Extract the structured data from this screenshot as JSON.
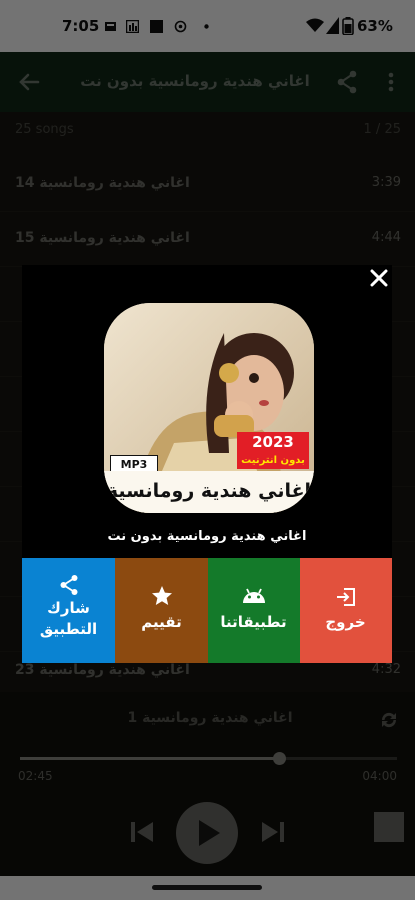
{
  "status_bar": {
    "time": "7:05",
    "battery": "63%"
  },
  "app_bar": {
    "title": "اغاني هندية رومانسية بدون نت"
  },
  "list": {
    "count_label": "25 songs",
    "page_index": "1 / 25",
    "rows": [
      {
        "title": "اغاني هندية رومانسية 14",
        "duration": "3:39"
      },
      {
        "title": "اغاني هندية رومانسية 15",
        "duration": "4:44"
      },
      {
        "title": "",
        "duration": ""
      },
      {
        "title": "",
        "duration": ""
      },
      {
        "title": "",
        "duration": ""
      },
      {
        "title": "",
        "duration": ""
      },
      {
        "title": "",
        "duration": ""
      },
      {
        "title": "",
        "duration": ""
      },
      {
        "title": "",
        "duration": ""
      },
      {
        "title": "اغاني هندية رومانسية 23",
        "duration": "4:32"
      }
    ]
  },
  "player": {
    "now_playing": "اغاني هندية رومانسية 1",
    "elapsed": "02:45",
    "total": "04:00",
    "progress": 0.688
  },
  "dialog": {
    "icon_badge_year": "2023",
    "icon_badge_offline": "بدون انترنيت",
    "icon_badge_format": "MP3",
    "icon_title": "اغاني هندية رومانسية",
    "app_name": "اغاني هندية رومانسية بدون نت",
    "actions": {
      "exit": "خروج",
      "our_apps": "تطبيقاتنا",
      "rate": "تقييم",
      "share_line1": "شارك",
      "share_line2": "التطبيق"
    },
    "colors": {
      "exit": "#e2513d",
      "our_apps": "#147a2a",
      "rate": "#8c4a10",
      "share": "#0a83d2"
    }
  }
}
